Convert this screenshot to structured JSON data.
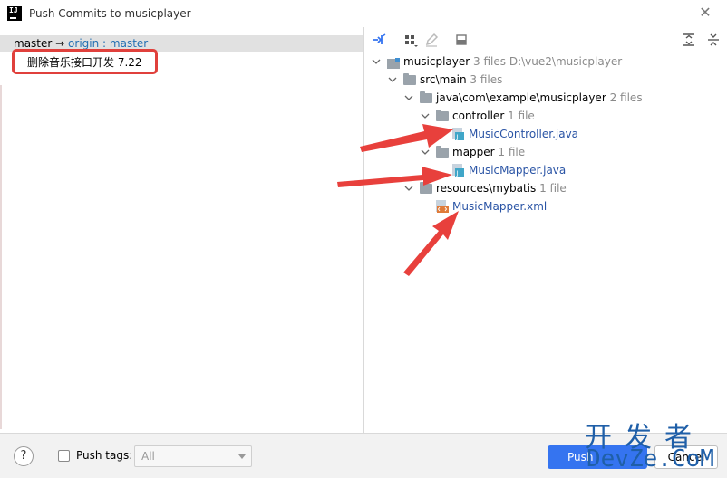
{
  "window": {
    "title": "Push Commits to musicplayer",
    "app_icon_text": "IJ"
  },
  "left": {
    "branch": {
      "local": "master",
      "arrow": "→",
      "remote": "origin",
      "separator": ":",
      "remote_branch": "master"
    },
    "commits": [
      {
        "message": "删除音乐接口开发 7.22"
      }
    ]
  },
  "right": {
    "toolbar": [
      "pin-icon",
      "group-by-icon",
      "edit-icon",
      "diff-icon",
      "expand-all-icon",
      "collapse-all-icon"
    ],
    "tree": {
      "root": {
        "name": "musicplayer",
        "hint": "3 files",
        "path": "D:\\vue2\\musicplayer"
      },
      "src": {
        "name": "src\\main",
        "hint": "3 files"
      },
      "pkg": {
        "name": "java\\com\\example\\musicplayer",
        "hint": "2 files"
      },
      "controller": {
        "name": "controller",
        "hint": "1 file"
      },
      "controller_file": "MusicController.java",
      "mapper": {
        "name": "mapper",
        "hint": "1 file"
      },
      "mapper_file": "MusicMapper.java",
      "resources": {
        "name": "resources\\mybatis",
        "hint": "1 file"
      },
      "xml_file": "MusicMapper.xml"
    }
  },
  "bottom": {
    "help": "?",
    "push_tags_label": "Push tags:",
    "push_tags_checked": false,
    "tags_select_value": "All",
    "push_button": "Push",
    "cancel_button": "Cancel"
  },
  "watermark": {
    "cn": "开发者",
    "en": "DevZe.CoM"
  },
  "colors": {
    "accent": "#3574f0",
    "link": "#2a54a5",
    "annotation": "#e0403c",
    "selected_row": "#e1e1e1"
  }
}
